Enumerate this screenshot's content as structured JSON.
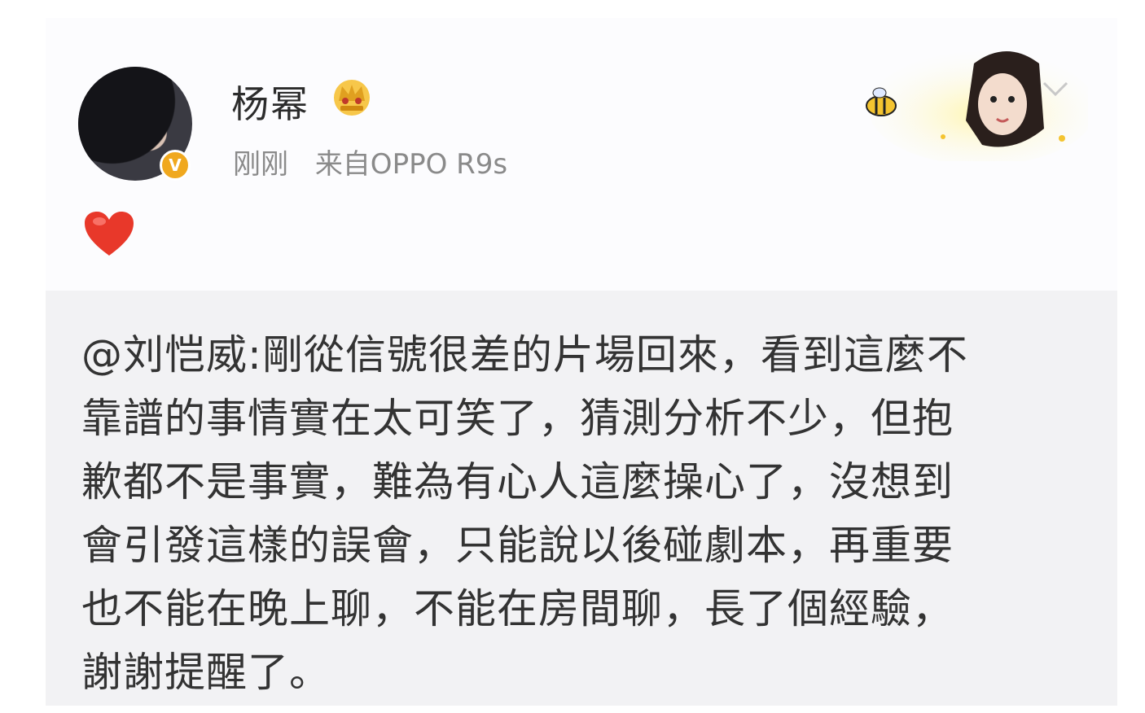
{
  "post": {
    "username": "杨幂",
    "time": "刚刚",
    "source": "来自OPPO R9s",
    "verified_badge": "V",
    "icons": [
      "crown-icon",
      "verified-icon",
      "heart-icon",
      "chevron-down-icon",
      "bee-icon"
    ],
    "colors": {
      "accent": "#f0a81e",
      "text": "#333333",
      "meta": "#8a8a8a",
      "heart": "#e8382a"
    },
    "content_lines": [
      "@刘恺威:剛從信號很差的片場回來，看到這麼不",
      "靠譜的事情實在太可笑了，猜測分析不少，但抱",
      "歉都不是事實，難為有心人這麼操心了，沒想到",
      "會引發這樣的誤會，只能說以後碰劇本，再重要",
      "也不能在晚上聊，不能在房間聊，長了個經驗，",
      "謝謝提醒了。"
    ]
  }
}
